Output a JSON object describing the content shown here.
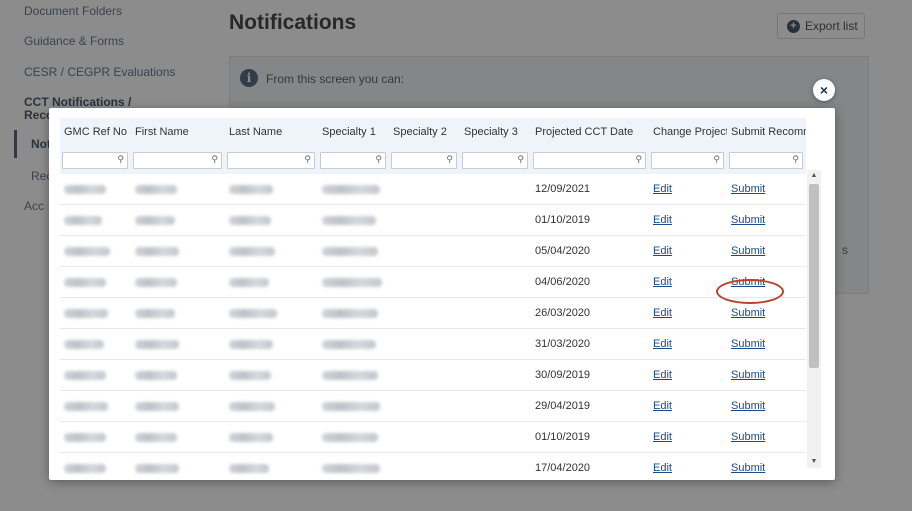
{
  "sidebar": {
    "items": [
      "Document Folders",
      "Guidance & Forms",
      "CESR / CEGPR Evaluations"
    ],
    "cct_group": "CCT Notifications / Reco",
    "fragments": [
      "Noti",
      "Rec",
      "Acc"
    ]
  },
  "page": {
    "title": "Notifications",
    "export_label": "Export list"
  },
  "info": {
    "text": "From this screen you can:",
    "tail": "s"
  },
  "modal": {
    "close_symbol": "×",
    "columns": [
      "GMC Ref No",
      "First Name",
      "Last Name",
      "Specialty 1",
      "Specialty 2",
      "Specialty 3",
      "Projected CCT Date",
      "Change Projecte",
      "Submit Recomm"
    ],
    "filter_icon": "search-icon",
    "edit_label": "Edit",
    "submit_label": "Submit",
    "rows": [
      {
        "date": "12/09/2021"
      },
      {
        "date": "01/10/2019"
      },
      {
        "date": "05/04/2020"
      },
      {
        "date": "04/06/2020"
      },
      {
        "date": "26/03/2020"
      },
      {
        "date": "31/03/2020"
      },
      {
        "date": "30/09/2019"
      },
      {
        "date": "29/04/2019"
      },
      {
        "date": "01/10/2019"
      },
      {
        "date": "17/04/2020"
      }
    ]
  },
  "colors": {
    "header_bg": "#eef4fa",
    "link": "#1a4a8a",
    "highlight": "#b8412f"
  }
}
